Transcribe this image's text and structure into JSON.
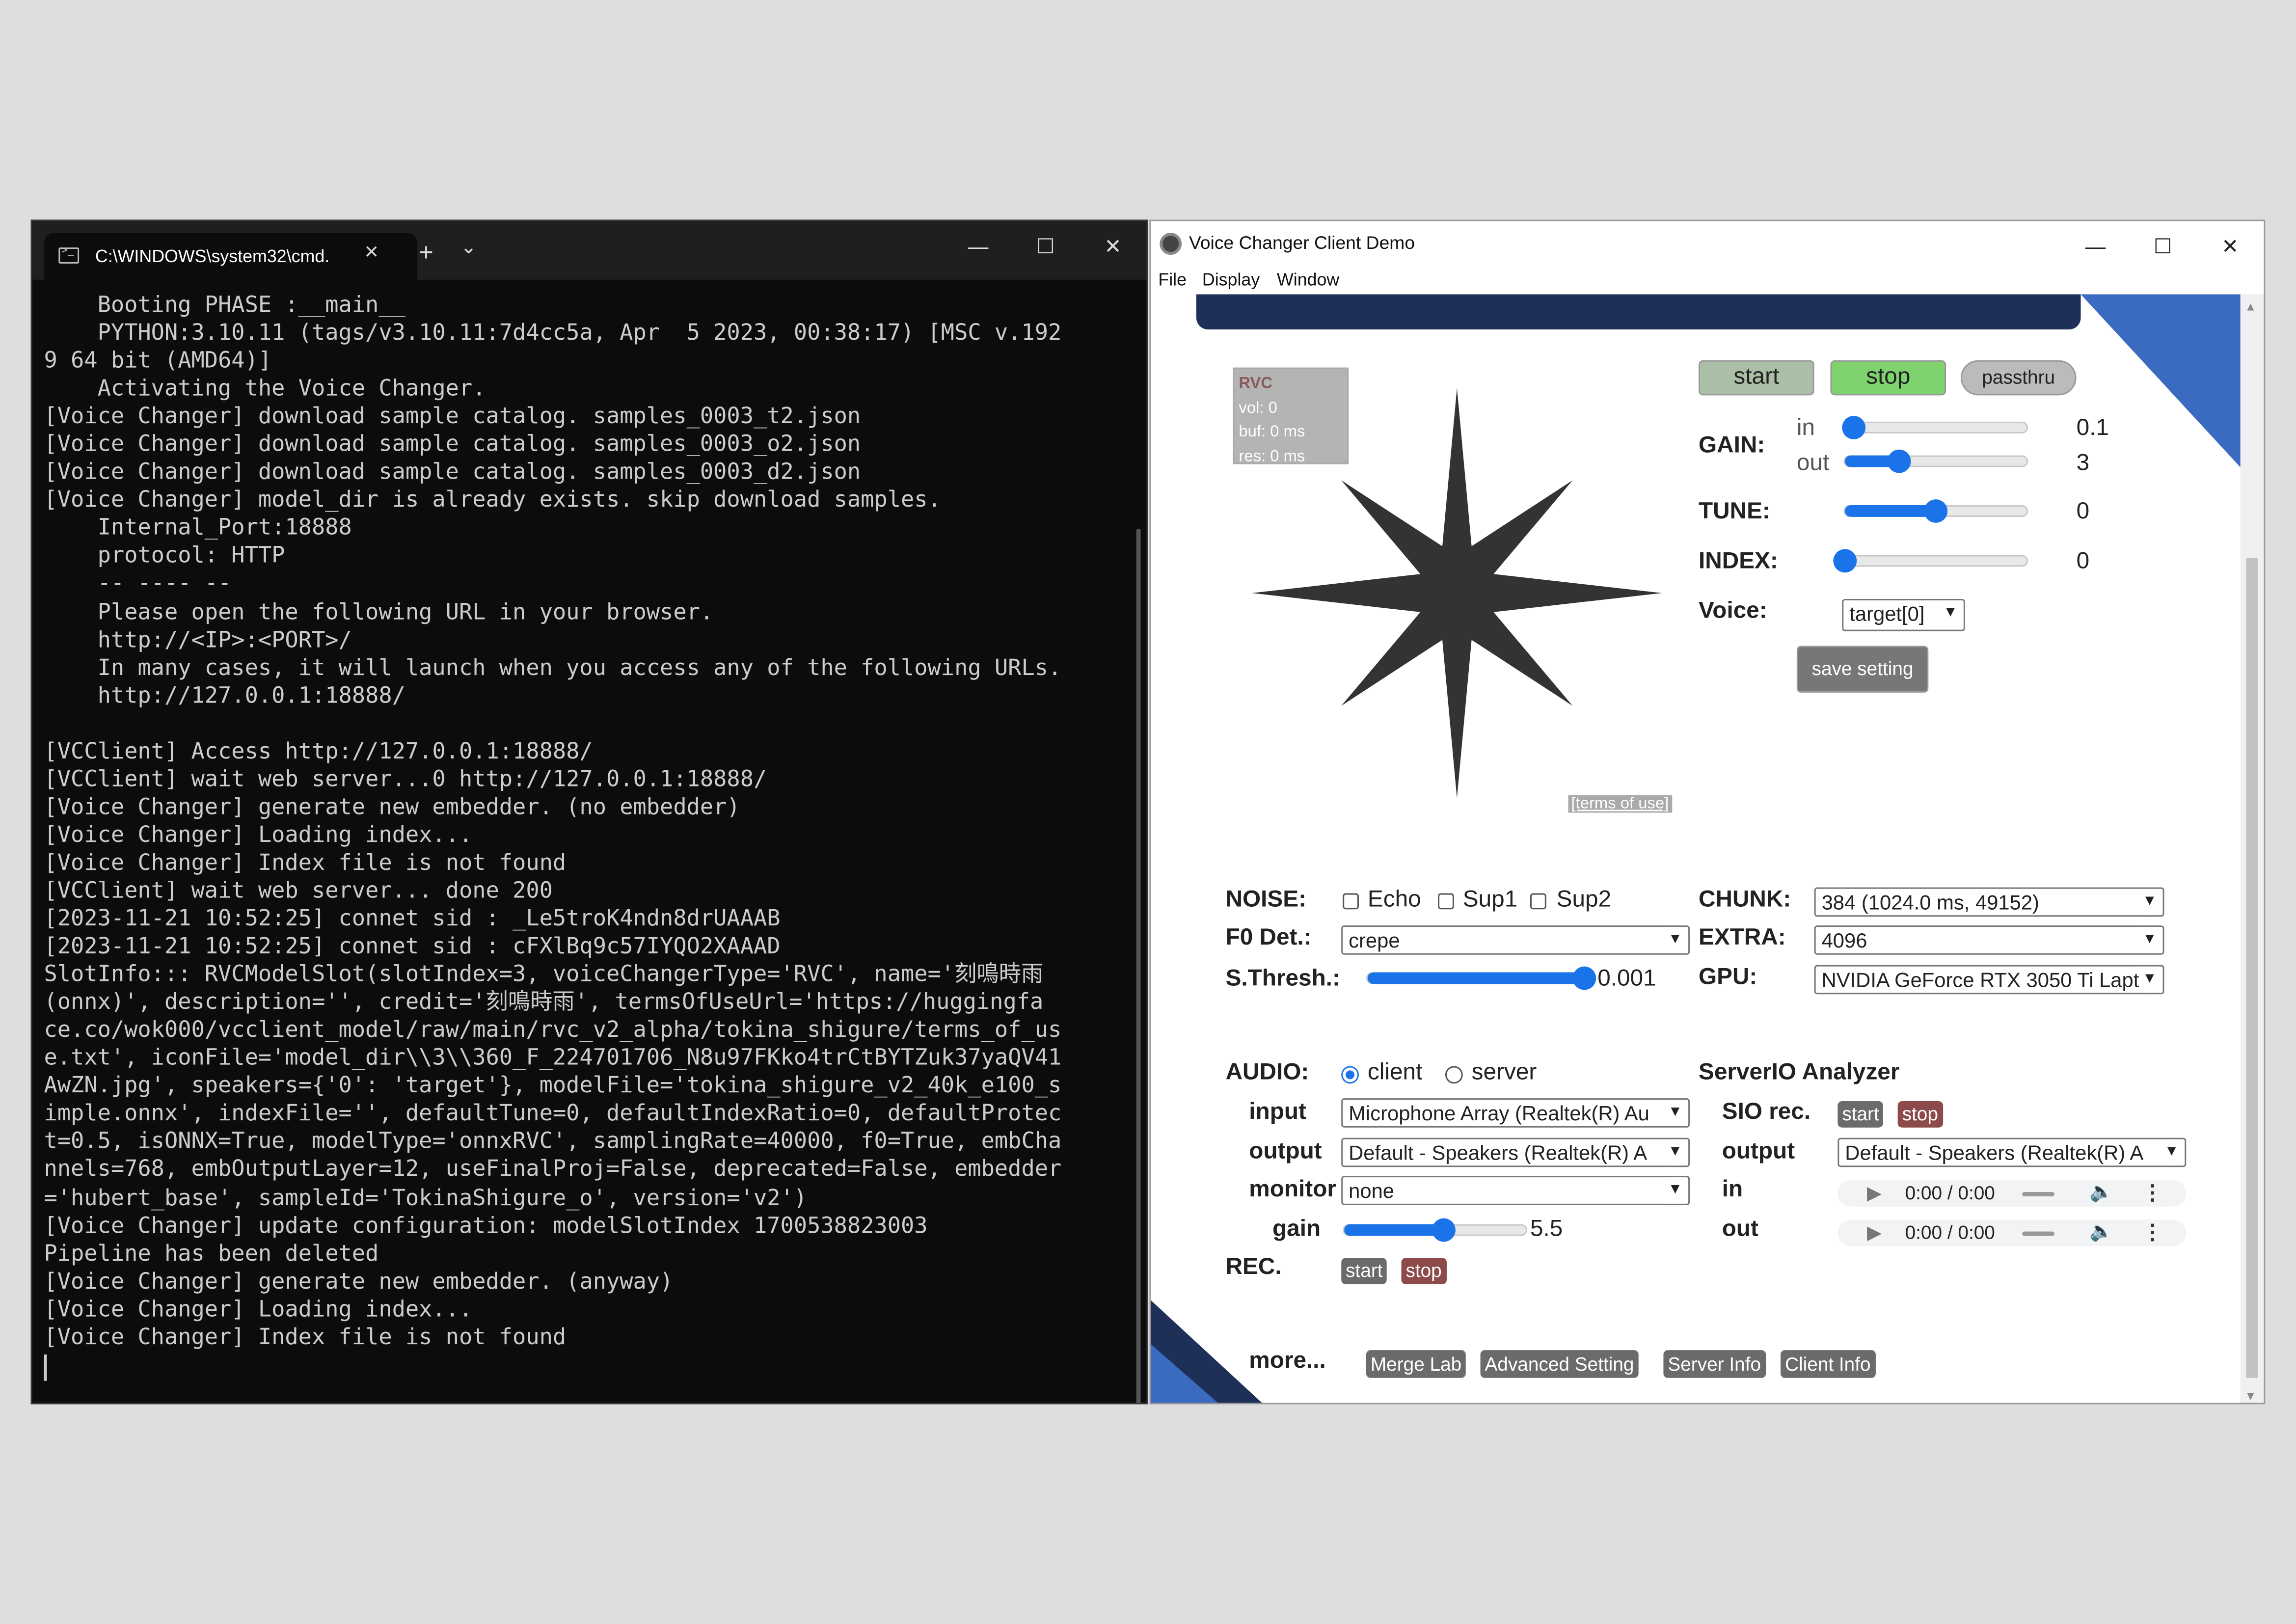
{
  "terminal": {
    "tab_title": "C:\\WINDOWS\\system32\\cmd.",
    "lines": [
      "    Booting PHASE :__main__",
      "    PYTHON:3.10.11 (tags/v3.10.11:7d4cc5a, Apr  5 2023, 00:38:17) [MSC v.192",
      "9 64 bit (AMD64)]",
      "    Activating the Voice Changer.",
      "[Voice Changer] download sample catalog. samples_0003_t2.json",
      "[Voice Changer] download sample catalog. samples_0003_o2.json",
      "[Voice Changer] download sample catalog. samples_0003_d2.json",
      "[Voice Changer] model_dir is already exists. skip download samples.",
      "    Internal_Port:18888",
      "    protocol: HTTP",
      "    -- ---- --",
      "    Please open the following URL in your browser.",
      "    http://<IP>:<PORT>/",
      "    In many cases, it will launch when you access any of the following URLs.",
      "    http://127.0.0.1:18888/",
      "",
      "[VCClient] Access http://127.0.0.1:18888/",
      "[VCClient] wait web server...0 http://127.0.0.1:18888/",
      "[Voice Changer] generate new embedder. (no embedder)",
      "[Voice Changer] Loading index...",
      "[Voice Changer] Index file is not found",
      "[VCClient] wait web server... done 200",
      "[2023-11-21 10:52:25] connet sid : _Le5troK4ndn8drUAAAB",
      "[2023-11-21 10:52:25] connet sid : cFXlBq9c57IYQO2XAAAD",
      "SlotInfo::: RVCModelSlot(slotIndex=3, voiceChangerType='RVC', name='刻鳴時雨",
      "(onnx)', description='', credit='刻鳴時雨', termsOfUseUrl='https://huggingfa",
      "ce.co/wok000/vcclient_model/raw/main/rvc_v2_alpha/tokina_shigure/terms_of_us",
      "e.txt', iconFile='model_dir\\\\3\\\\360_F_224701706_N8u97FKko4trCtBYTZuk37yaQV41",
      "AwZN.jpg', speakers={'0': 'target'}, modelFile='tokina_shigure_v2_40k_e100_s",
      "imple.onnx', indexFile='', defaultTune=0, defaultIndexRatio=0, defaultProtec",
      "t=0.5, isONNX=True, modelType='onnxRVC', samplingRate=40000, f0=True, embCha",
      "nnels=768, embOutputLayer=12, useFinalProj=False, deprecated=False, embedder",
      "='hubert_base', sampleId='TokinaShigure_o', version='v2')",
      "[Voice Changer] update configuration: modelSlotIndex 1700538823003",
      "Pipeline has been deleted",
      "[Voice Changer] generate new embedder. (anyway)",
      "[Voice Changer] Loading index...",
      "[Voice Changer] Index file is not found"
    ]
  },
  "app": {
    "title": "Voice Changer Client Demo",
    "menu": [
      "File",
      "Display",
      "Window"
    ],
    "status": {
      "model": "RVC",
      "vol": "vol: 0",
      "buf": "buf: 0 ms",
      "res": "res: 0 ms"
    },
    "terms_of_use": "[terms of use]",
    "control": {
      "start": "start",
      "stop": "stop",
      "passthru": "passthru",
      "gain_label": "GAIN:",
      "in_label": "in",
      "out_label": "out",
      "gain_in": "0.1",
      "gain_out": "3",
      "gain_in_level": 0.05,
      "gain_out_level": 0.3,
      "tune_label": "TUNE:",
      "tune_value": "0",
      "tune_level": 0.5,
      "index_label": "INDEX:",
      "index_value": "0",
      "index_level": 0.0,
      "voice_label": "Voice:",
      "voice_value": "target[0]",
      "save_setting": "save setting"
    },
    "quality": {
      "noise_label": "NOISE:",
      "echo": "Echo",
      "sup1": "Sup1",
      "sup2": "Sup2",
      "f0_label": "F0 Det.:",
      "f0_value": "crepe",
      "sthresh_label": "S.Thresh.:",
      "sthresh_value": "0.001",
      "sthresh_level": 1.0,
      "chunk_label": "CHUNK:",
      "chunk_value": "384 (1024.0 ms, 49152)",
      "extra_label": "EXTRA:",
      "extra_value": "4096",
      "gpu_label": "GPU:",
      "gpu_value": "NVIDIA GeForce RTX 3050 Ti Laptc"
    },
    "audio": {
      "audio_label": "AUDIO:",
      "client": "client",
      "server": "server",
      "input_label": "input",
      "input_value": "Microphone Array (Realtek(R) Au",
      "output_label": "output",
      "output_value": "Default - Speakers (Realtek(R) A",
      "monitor_label": "monitor",
      "monitor_value": "none",
      "gain_label": "gain",
      "gain_value": "5.5",
      "gain_level": 0.55,
      "rec_label": "REC.",
      "rec_start": "start",
      "rec_stop": "stop"
    },
    "analyzer": {
      "title": "ServerIO Analyzer",
      "sio_label": "SIO rec.",
      "sio_start": "start",
      "sio_stop": "stop",
      "output_label": "output",
      "output_value": "Default - Speakers (Realtek(R) A",
      "in_label": "in",
      "out_label": "out",
      "in_time": "0:00 / 0:00",
      "out_time": "0:00 / 0:00"
    },
    "more": {
      "label": "more...",
      "buttons": [
        "Merge Lab",
        "Advanced Setting",
        "Server Info",
        "Client Info"
      ]
    }
  }
}
